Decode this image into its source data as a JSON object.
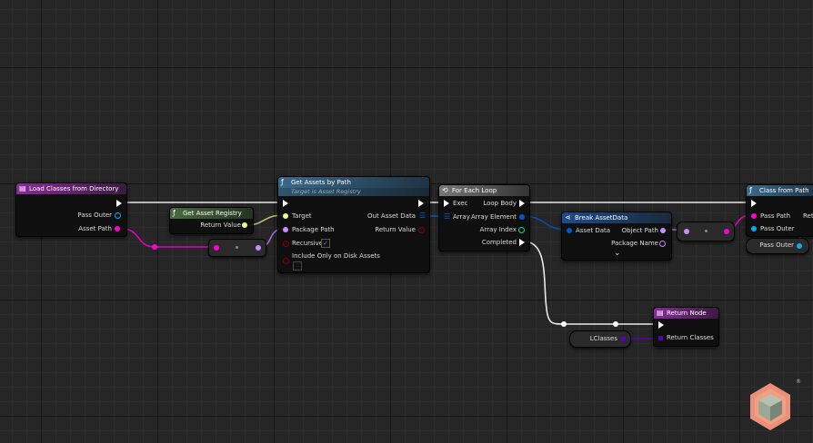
{
  "nodes": {
    "load_classes": {
      "title": "Load Classes from Directory",
      "pins": {
        "pass_outer": "Pass Outer",
        "asset_path": "Asset Path"
      }
    },
    "get_asset_registry": {
      "title": "Get Asset Registry",
      "pins": {
        "return_value": "Return Value"
      }
    },
    "get_assets_by_path": {
      "title": "Get Assets by Path",
      "subtitle": "Target is Asset Registry",
      "pins": {
        "target": "Target",
        "package_path": "Package Path",
        "recursive": "Recursive",
        "include_disk": "Include Only on Disk Assets",
        "out_asset_data": "Out Asset Data",
        "return_value": "Return Value"
      },
      "recursive_checked": true,
      "include_disk_checked": false
    },
    "for_each_loop": {
      "title": "For Each Loop",
      "pins": {
        "exec": "Exec",
        "array": "Array",
        "loop_body": "Loop Body",
        "array_element": "Array Element",
        "array_index": "Array Index",
        "completed": "Completed"
      }
    },
    "break_asset_data": {
      "title": "Break AssetData",
      "pins": {
        "asset_data": "Asset Data",
        "object_path": "Object Path",
        "package_name": "Package Name"
      },
      "expand": "⌄"
    },
    "class_from_path": {
      "title": "Class from Path",
      "pins": {
        "pass_path": "Pass Path",
        "pass_outer": "Pass Outer",
        "return": "Retu"
      }
    },
    "pass_outer_var": {
      "label": "Pass Outer"
    },
    "return_node": {
      "title": "Return Node",
      "pins": {
        "return_classes": "Return Classes"
      }
    },
    "lclasses_var": {
      "label": "LClasses"
    }
  },
  "colors": {
    "exec": "#ffffff",
    "string": "#ff00d4",
    "name": "#c88cff",
    "object": "#0fa8f0",
    "struct": "#0058c8",
    "bool": "#8a0000",
    "int": "#1ddc8a",
    "class": "#5a00b4",
    "registry": "#e8ff8c"
  },
  "logo_mark": "®"
}
